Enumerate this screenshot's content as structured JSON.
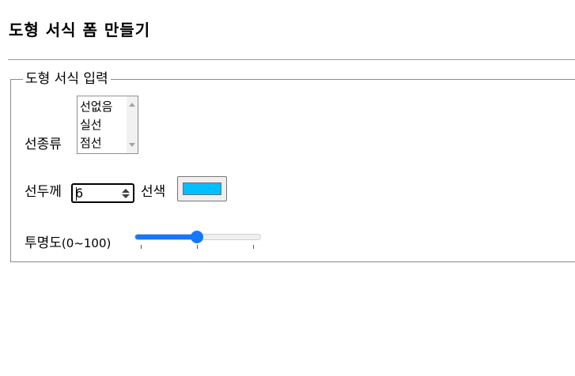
{
  "page": {
    "title": "도형 서식 폼 만들기"
  },
  "form": {
    "legend": "도형 서식 입력",
    "line_type": {
      "label": "선종류",
      "options": [
        "선없음",
        "실선",
        "점선"
      ]
    },
    "line_width": {
      "label": "선두께",
      "value": "6"
    },
    "line_color": {
      "label": "선색",
      "value": "#00bfff"
    },
    "opacity": {
      "label": "투명도",
      "range_label": "(0~100)",
      "min": 0,
      "max": 100,
      "value": 50
    }
  }
}
